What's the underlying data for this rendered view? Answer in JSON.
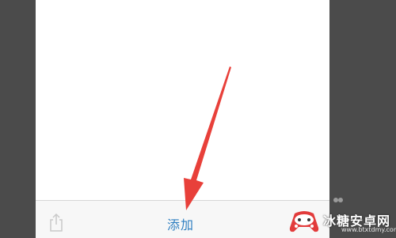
{
  "toolbar": {
    "add_label": "添加"
  },
  "icons": {
    "share": "share-icon",
    "arrow": "red-arrow-annotation",
    "watermark_logo": "game-controller-logo"
  },
  "watermark": {
    "title": "冰糖安卓网",
    "url": "www.btxtdmy.com"
  },
  "colors": {
    "link_blue": "#2f7fc1",
    "arrow_red": "#e8403a",
    "frame_gray": "#4b4b4b"
  }
}
